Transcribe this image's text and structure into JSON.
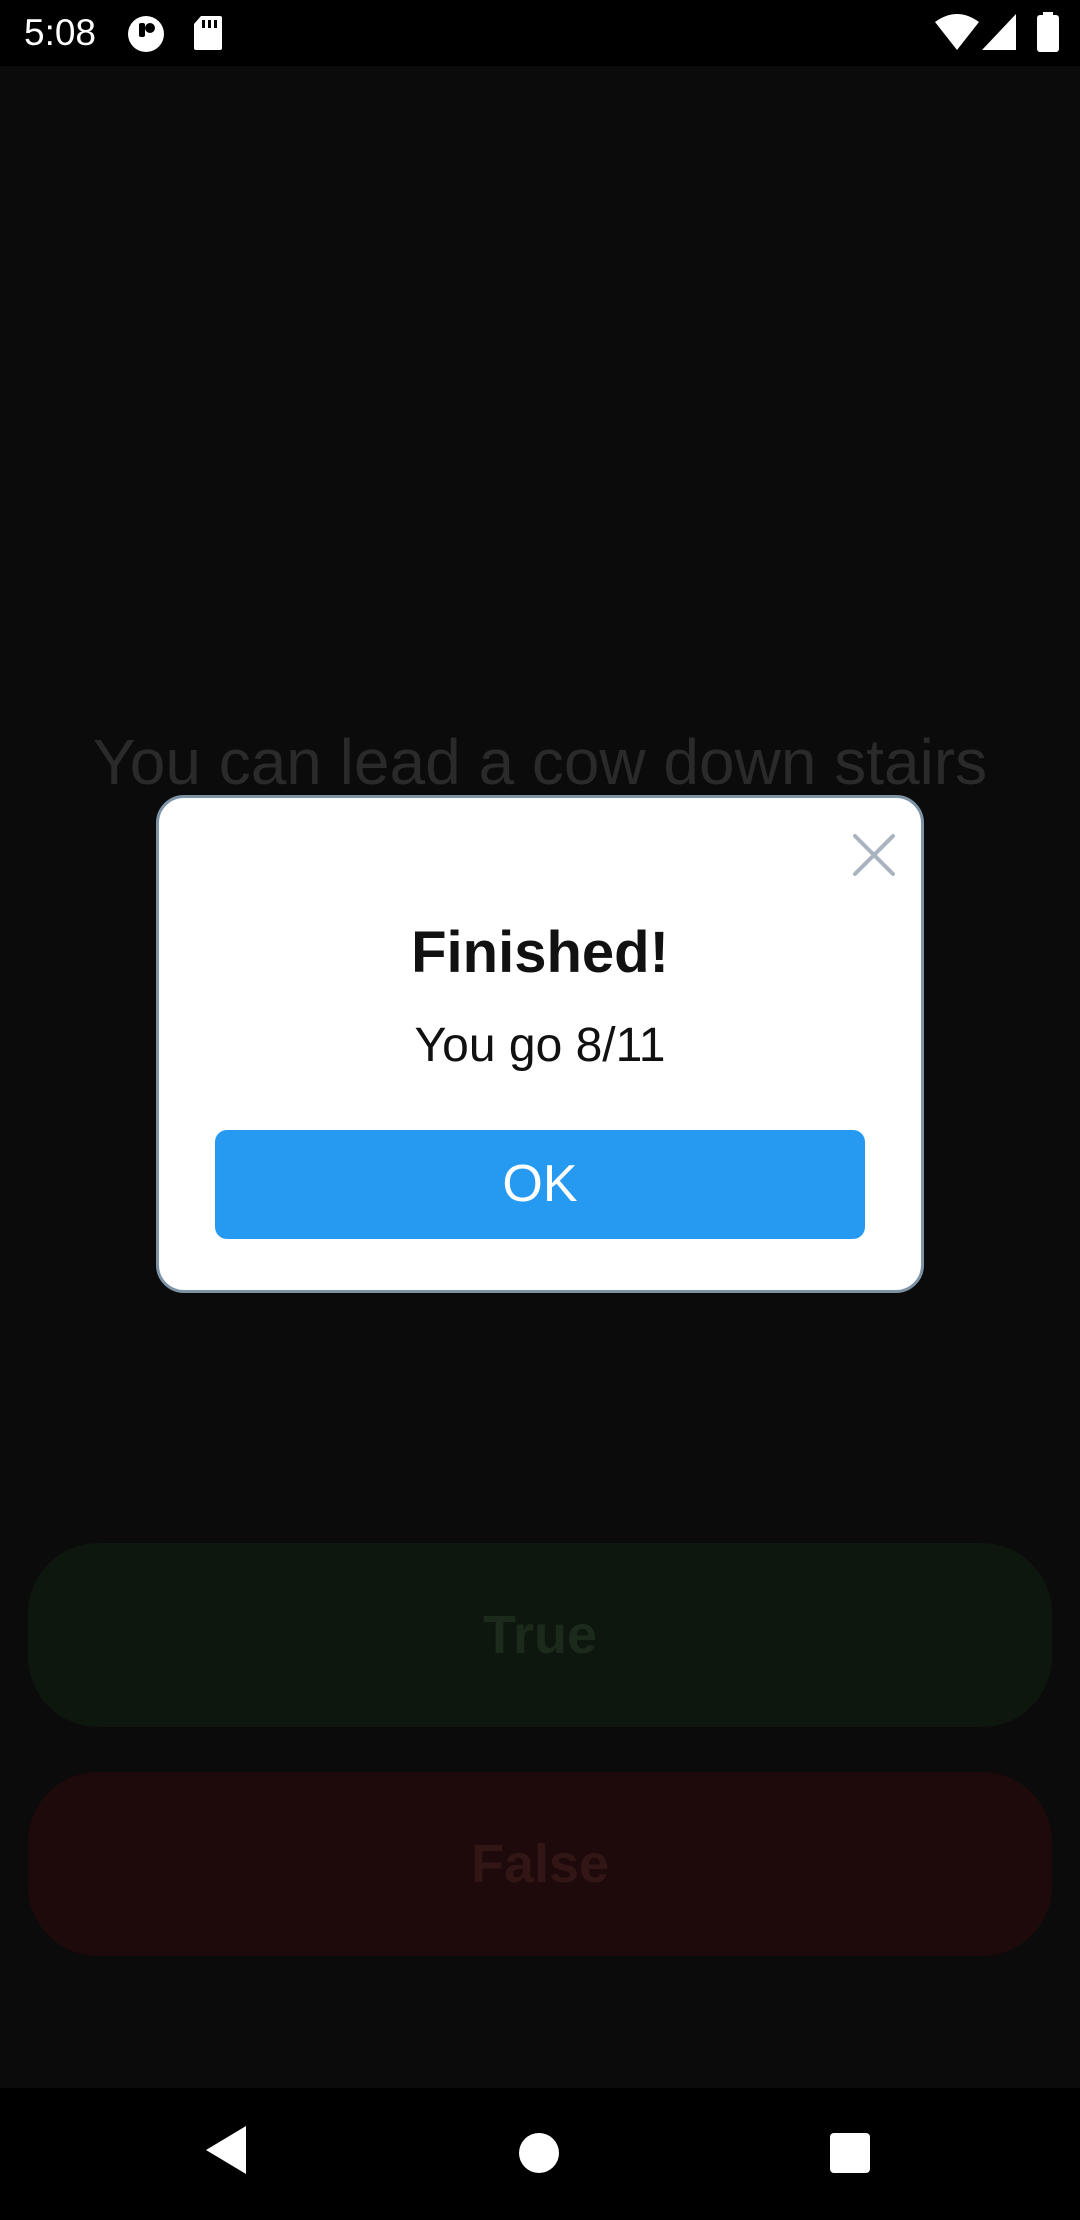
{
  "status_bar": {
    "time": "5:08",
    "icons": [
      "app-notification-icon",
      "sd-card-icon",
      "wifi-icon",
      "cellular-signal-icon",
      "battery-icon"
    ]
  },
  "quiz": {
    "question": "You can lead a cow down stairs",
    "true_label": "True",
    "false_label": "False"
  },
  "dialog": {
    "title": "Finished!",
    "message": "You go 8/11",
    "ok_label": "OK",
    "close_icon": "close-icon"
  },
  "nav_bar": {
    "icons": [
      "back-icon",
      "home-icon",
      "recents-icon"
    ]
  },
  "colors": {
    "ok_button": "#2699f0",
    "dialog_border": "#7d93a6",
    "true_button": "#0d170d",
    "false_button": "#1e0a0a"
  }
}
